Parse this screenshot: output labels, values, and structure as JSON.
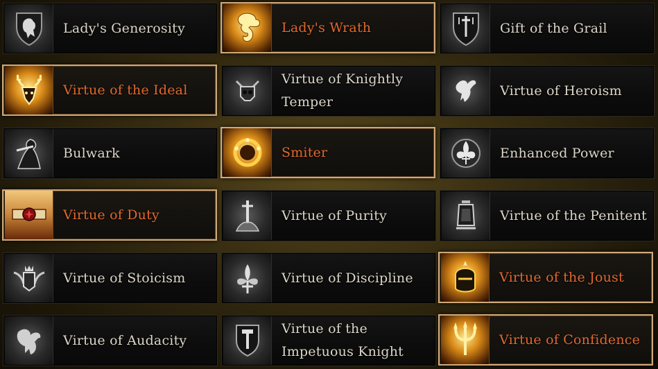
{
  "colors": {
    "active_text": "#e0692f",
    "inactive_text": "#dcd6c8",
    "active_border": "#cfa97a"
  },
  "virtues": [
    {
      "label": "Lady's Generosity",
      "active": false,
      "icon": "lion-shield-icon"
    },
    {
      "label": "Lady's Wrath",
      "active": true,
      "icon": "dragon-icon"
    },
    {
      "label": "Gift of the Grail",
      "active": false,
      "icon": "grail-shield-icon"
    },
    {
      "label": "Virtue of the Ideal",
      "active": true,
      "icon": "stag-head-icon"
    },
    {
      "label": "Virtue of Knightly Temper",
      "active": false,
      "icon": "horned-skull-icon"
    },
    {
      "label": "Virtue of Heroism",
      "active": false,
      "icon": "pegasus-icon"
    },
    {
      "label": "Bulwark",
      "active": false,
      "icon": "cloaked-figure-icon"
    },
    {
      "label": "Smiter",
      "active": true,
      "icon": "burning-ring-icon"
    },
    {
      "label": "Enhanced Power",
      "active": false,
      "icon": "fleur-de-lis-icon"
    },
    {
      "label": "Virtue of Duty",
      "active": true,
      "icon": "banner-seal-icon"
    },
    {
      "label": "Virtue of Purity",
      "active": false,
      "icon": "sword-in-stone-icon"
    },
    {
      "label": "Virtue of the Penitent",
      "active": false,
      "icon": "lantern-icon"
    },
    {
      "label": "Virtue of Stoicism",
      "active": false,
      "icon": "winged-crown-icon"
    },
    {
      "label": "Virtue of Discipline",
      "active": false,
      "icon": "fleur-crest-icon"
    },
    {
      "label": "Virtue of the Joust",
      "active": true,
      "icon": "knight-helm-icon"
    },
    {
      "label": "Virtue of Audacity",
      "active": false,
      "icon": "griffon-icon"
    },
    {
      "label": "Virtue of the Impetuous Knight",
      "active": false,
      "icon": "hammer-shield-icon"
    },
    {
      "label": "Virtue of Confidence",
      "active": true,
      "icon": "trident-icon"
    }
  ]
}
